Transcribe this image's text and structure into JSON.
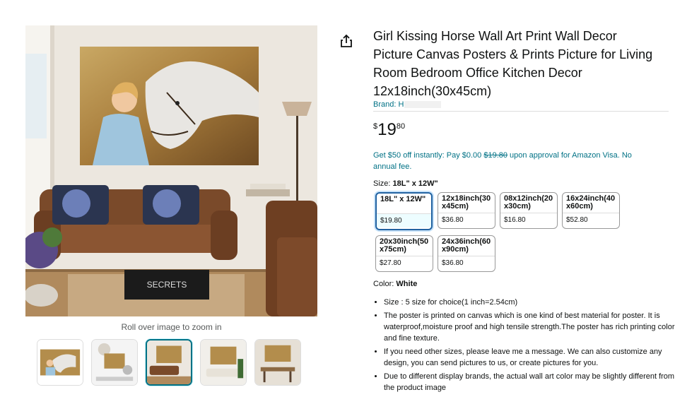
{
  "gallery": {
    "zoom_hint": "Roll over image to zoom in",
    "thumbnails": [
      "thumb-1",
      "thumb-2",
      "thumb-3",
      "thumb-4",
      "thumb-5"
    ],
    "selected_thumbnail_index": 2,
    "book_cover_text": "SECRETS"
  },
  "share_icon": "share-icon",
  "product": {
    "title": "Girl Kissing Horse Wall Art Print Wall Decor Picture Canvas Posters & Prints Picture for Living Room Bedroom Office Kitchen Decor 12x18inch(30x45cm)",
    "brand_label": "Brand: H",
    "price": {
      "symbol": "$",
      "whole": "19",
      "fraction": "80"
    },
    "promo": {
      "prefix": "Get $50 off instantly: Pay $0.00 ",
      "strike": "$19.80",
      "suffix": " upon approval for Amazon Visa. No annual fee."
    },
    "size": {
      "label": "Size: ",
      "selected": "18L\" x 12W\"",
      "options": [
        {
          "name": "18L\" x 12W\"",
          "price": "$19.80"
        },
        {
          "name": "12x18inch(30 x45cm)",
          "price": "$36.80"
        },
        {
          "name": "08x12inch(20 x30cm)",
          "price": "$16.80"
        },
        {
          "name": "16x24inch(40 x60cm)",
          "price": "$52.80"
        },
        {
          "name": "20x30inch(50 x75cm)",
          "price": "$27.80"
        },
        {
          "name": "24x36inch(60 x90cm)",
          "price": "$36.80"
        }
      ]
    },
    "color": {
      "label": "Color: ",
      "value": "White"
    },
    "bullets": [
      "Size : 5 size for choice(1 inch=2.54cm)",
      "The poster is printed on canvas which is one kind of best material for poster. It is waterproof,moisture proof and high tensile strength.The poster has rich printing color and fine texture.",
      "If you need other sizes, please leave me a message. We can also customize any design, you can send pictures to us, or create pictures for you.",
      "Due to different display brands, the actual wall art color may be slightly different from the product image"
    ]
  }
}
